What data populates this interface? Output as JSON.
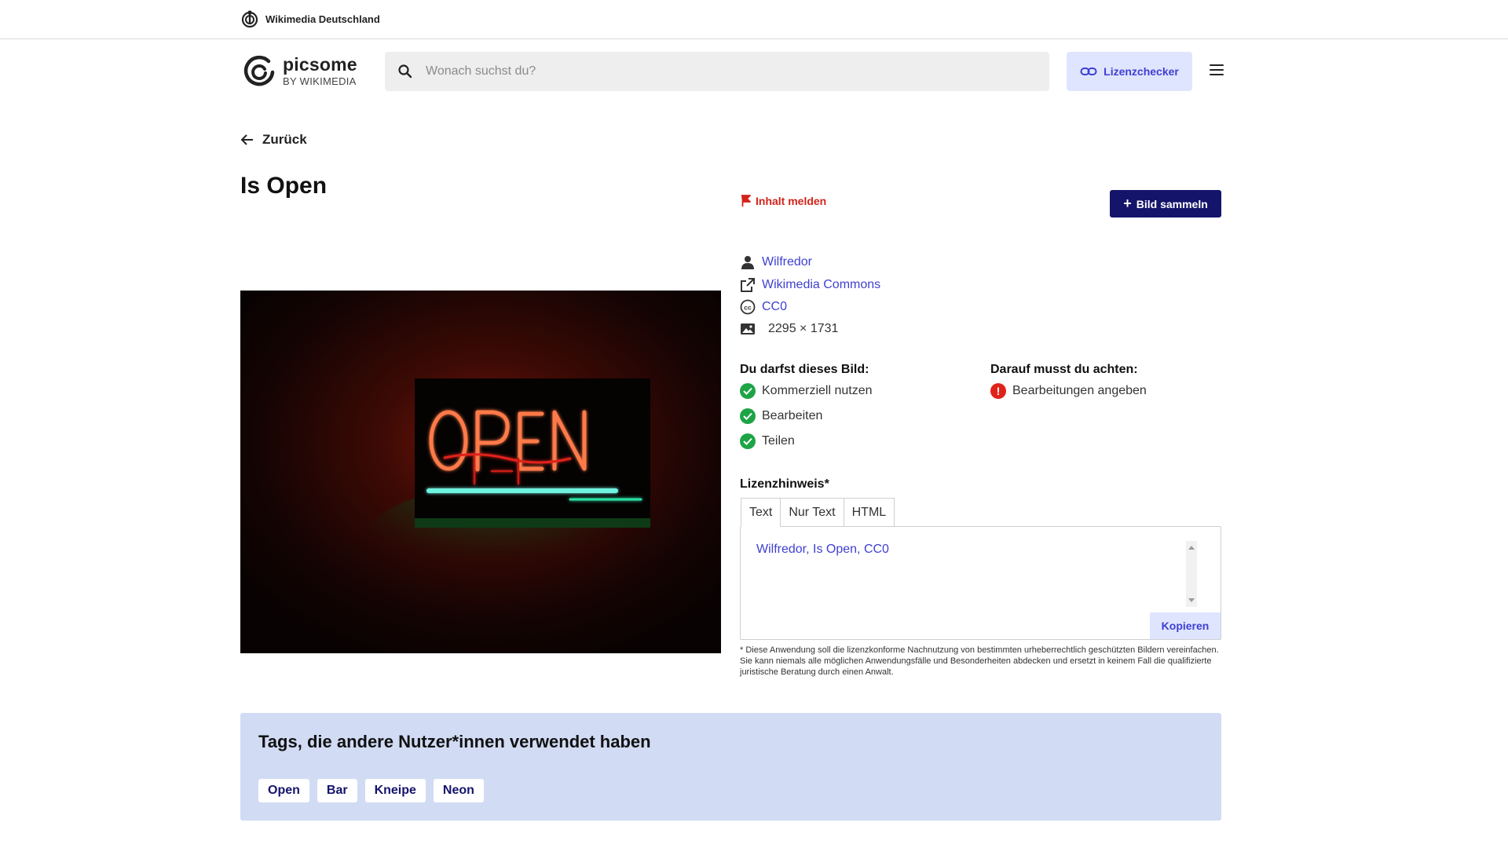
{
  "topbar": {
    "org_name": "Wikimedia Deutschland"
  },
  "header": {
    "brand_name": "picsome",
    "brand_sub": "BY WIKIMEDIA",
    "search_placeholder": "Wonach suchst du?",
    "license_checker_label": "Lizenzchecker"
  },
  "nav": {
    "back_label": "Zurück"
  },
  "image": {
    "title": "Is Open",
    "report_label": "Inhalt melden",
    "collect_label": "Bild sammeln",
    "author": "Wilfredor",
    "source": "Wikimedia Commons",
    "license": "CC0",
    "width": "2295",
    "times": "×",
    "height": "1731"
  },
  "permissions": {
    "allowed_heading": "Du darfst dieses Bild:",
    "allowed": [
      "Kommerziell nutzen",
      "Bearbeiten",
      "Teilen"
    ],
    "attention_heading": "Darauf musst du achten:",
    "attention": [
      "Bearbeitungen angeben"
    ]
  },
  "license_notice": {
    "heading": "Lizenzhinweis*",
    "tabs": [
      "Text",
      "Nur Text",
      "HTML"
    ],
    "active_tab": "Text",
    "text": "Wilfredor, Is Open, CC0",
    "copy_label": "Kopieren",
    "disclaimer": "* Diese Anwendung soll die lizenzkonforme Nachnutzung von bestimmten urheberrechtlich geschützten Bildern vereinfachen. Sie kann niemals alle möglichen Anwendungsfälle und Besonderheiten abdecken und ersetzt in keinem Fall die qualifizierte juristische Beratung durch einen Anwalt."
  },
  "tags": {
    "heading": "Tags, die andere Nutzer*innen verwendet haben",
    "items": [
      "Open",
      "Bar",
      "Kneipe",
      "Neon"
    ]
  },
  "colors": {
    "accent": "#3f3fd1",
    "primary_button": "#14146b",
    "report_red": "#d3231a",
    "success_green": "#1ea446",
    "tags_panel": "#d1dbf4"
  },
  "icons": [
    "wikimedia-logo-icon",
    "picsome-logo-icon",
    "search-icon",
    "link-icon",
    "menu-icon",
    "arrow-left-icon",
    "flag-icon",
    "plus-icon",
    "user-icon",
    "external-link-icon",
    "creative-commons-icon",
    "image-icon",
    "check-icon",
    "warning-icon"
  ]
}
